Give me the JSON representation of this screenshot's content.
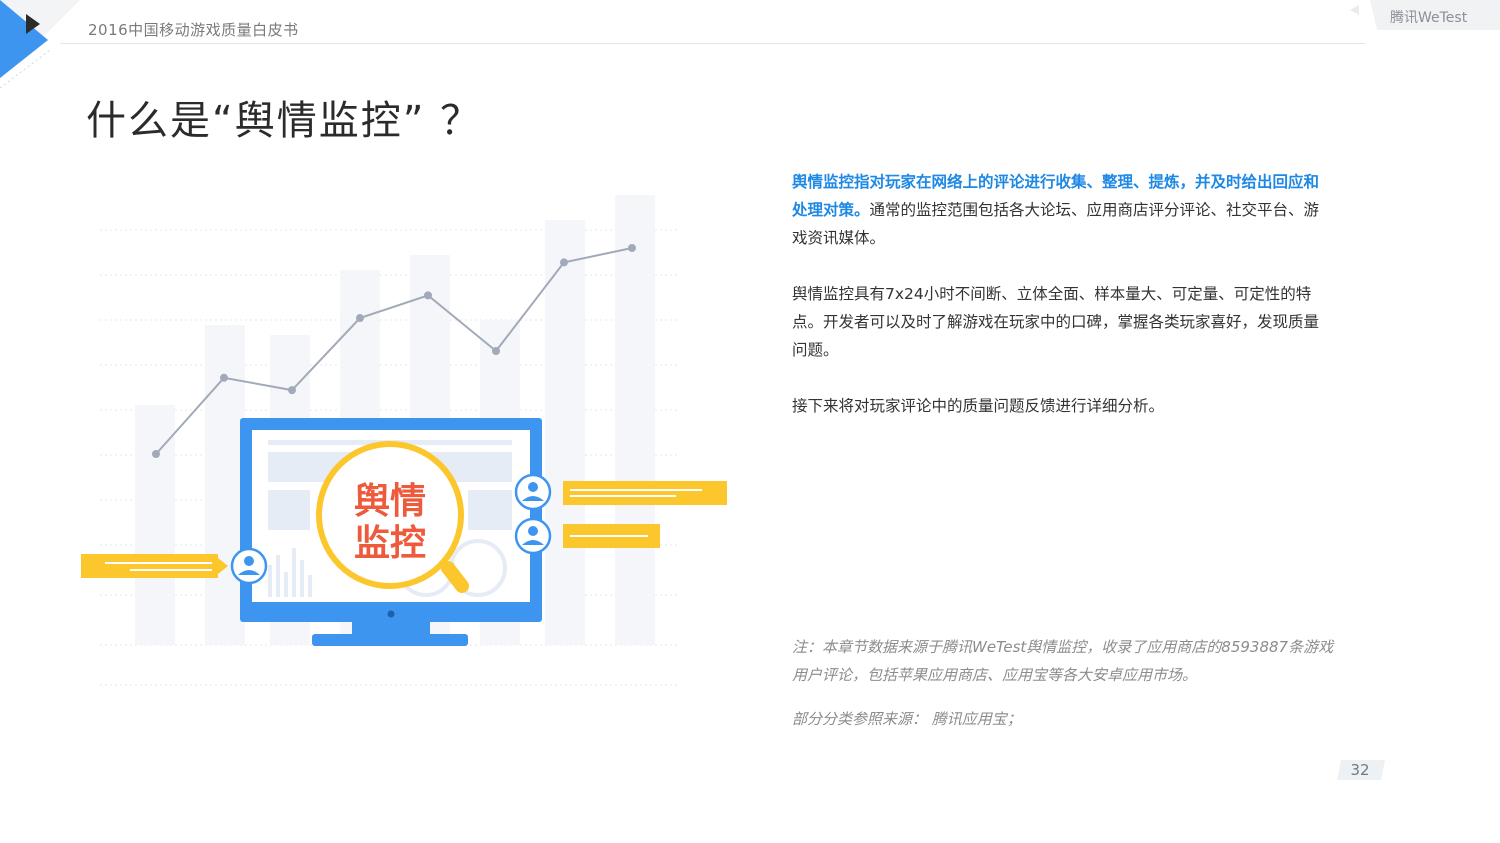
{
  "header": {
    "doc_title": "2016中国移动游戏质量白皮书",
    "brand": "腾讯WeTest"
  },
  "page": {
    "title": "什么是“舆情监控”  ？",
    "page_number": "32"
  },
  "illustration": {
    "badge_text_line1": "舆情",
    "badge_text_line2": "监控",
    "trend_values": [
      0.0,
      0.37,
      0.31,
      0.66,
      0.77,
      0.5,
      0.93,
      1.0
    ]
  },
  "body": {
    "p1_highlight": "舆情监控指对玩家在网络上的评论进行收集、整理、提炼，并及时给出回应和处理对策。",
    "p1_rest": "通常的监控范围包括各大论坛、应用商店评分评论、社交平台、游戏资讯媒体。",
    "p2": "舆情监控具有7x24小时不间断、立体全面、样本量大、可定量、可定性的特点。开发者可以及时了解游戏在玩家中的口碑，掌握各类玩家喜好，发现质量问题。",
    "p3": "接下来将对玩家评论中的质量问题反馈进行详细分析。"
  },
  "notes": {
    "n1": "注：本章节数据来源于腾讯WeTest舆情监控，收录了应用商店的8593887条游戏用户评论，包括苹果应用商店、应用宝等各大安卓应用市场。",
    "n2": "部分分类参照来源： 腾讯应用宝；"
  },
  "colors": {
    "accent_blue": "#3d95f0",
    "highlight_blue": "#1e88e5",
    "yellow": "#fbc72c",
    "badge_red": "#ee5a3c",
    "trend_gray": "#a2a9b8"
  }
}
